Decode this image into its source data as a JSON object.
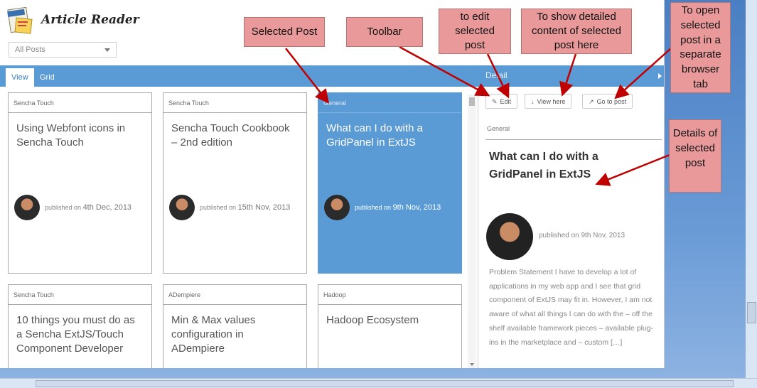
{
  "app": {
    "title": "Article Reader"
  },
  "filter": {
    "value": "All Posts"
  },
  "tabs": [
    {
      "label": "View"
    },
    {
      "label": "Grid"
    }
  ],
  "detail_panel": {
    "header": "Detail",
    "toolbar": {
      "edit": "Edit",
      "view_here": "View here",
      "go_to_post": "Go to post"
    },
    "category": "General",
    "title": "What can I do with a GridPanel in ExtJS",
    "published": "published on 9th Nov, 2013",
    "excerpt": "Problem Statement I have to develop a lot of applications in my web app and I see that grid component of ExtJS may fit in. However, I am not aware of what all things I can do with the – off the shelf available framework pieces – available plug-ins in the marketplace and – custom […]"
  },
  "posts": [
    {
      "category": "Sencha Touch",
      "title": "Using Webfont icons in Sencha Touch",
      "published_prefix": "published on",
      "date": "4th Dec, 2013"
    },
    {
      "category": "Sencha Touch",
      "title": "Sencha Touch Cookbook – 2nd edition",
      "published_prefix": "published on",
      "date": "15th Nov, 2013"
    },
    {
      "category": "General",
      "title": "What can I do with a GridPanel in ExtJS",
      "published_prefix": "published on",
      "date": "9th Nov, 2013"
    },
    {
      "category": "Sencha Touch",
      "title": "10 things you must do as a Sencha ExtJS/Touch Component Developer"
    },
    {
      "category": "ADempiere",
      "title": "Min & Max values configuration in ADempiere"
    },
    {
      "category": "Hadoop",
      "title": "Hadoop Ecosystem"
    }
  ],
  "annotations": {
    "selected_post": "Selected Post",
    "toolbar": "Toolbar",
    "edit": "to edit selected post",
    "view_here": "To show detailed content of selected post here",
    "go_to_post": "To open selected post in a separate browser tab",
    "details": "Details of selected post"
  },
  "colors": {
    "accent": "#5b9bd5",
    "note_fill": "#e9999a",
    "note_arrow": "#c00000"
  }
}
